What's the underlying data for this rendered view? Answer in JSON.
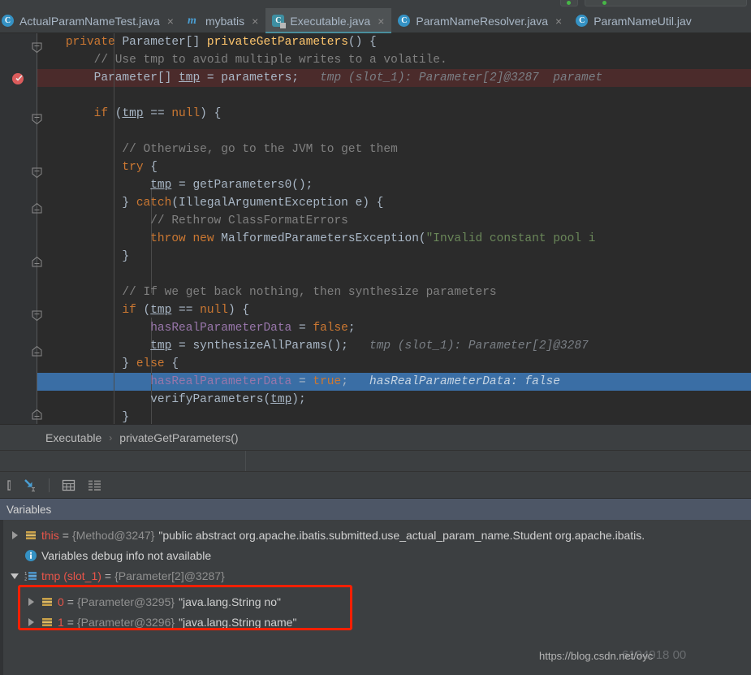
{
  "window": {
    "theme_bg": "#3c3f41",
    "editor_bg": "#2b2b2b",
    "accent": "#3a6ea5"
  },
  "tabs": [
    {
      "label": "ActualParamNameTest.java",
      "icon": "java-class-icon",
      "close": "×",
      "active": false
    },
    {
      "label": "mybatis",
      "icon": "maven-module-icon",
      "close": "×",
      "active": false
    },
    {
      "label": "Executable.java",
      "icon": "java-class-readonly-icon",
      "close": "×",
      "active": true
    },
    {
      "label": "ParamNameResolver.java",
      "icon": "java-class-icon",
      "close": "×",
      "active": false
    },
    {
      "label": "ParamNameUtil.jav",
      "icon": "java-class-icon",
      "close": "",
      "active": false
    }
  ],
  "editor": {
    "lines": [
      {
        "indent": 4,
        "tokens": [
          {
            "t": "private ",
            "c": "kw"
          },
          {
            "t": "Parameter",
            "c": "type"
          },
          {
            "t": "[] ",
            "c": "type"
          },
          {
            "t": "privateGetParameters",
            "c": "fn"
          },
          {
            "t": "() {",
            "c": "type"
          }
        ]
      },
      {
        "indent": 8,
        "tokens": [
          {
            "t": "// Use tmp to avoid multiple writes to a volatile.",
            "c": "cmt"
          }
        ]
      },
      {
        "indent": 8,
        "highlight": "red",
        "tokens": [
          {
            "t": "Parameter",
            "c": "type"
          },
          {
            "t": "[] ",
            "c": "type"
          },
          {
            "t": "tmp",
            "c": "loc"
          },
          {
            "t": " = parameters;",
            "c": "type"
          },
          {
            "t": "   tmp (slot_1): Parameter[2]@3287  paramet",
            "c": "hint"
          }
        ]
      },
      {
        "indent": 0,
        "tokens": []
      },
      {
        "indent": 8,
        "tokens": [
          {
            "t": "if",
            "c": "kw"
          },
          {
            "t": " (",
            "c": "type"
          },
          {
            "t": "tmp",
            "c": "loc"
          },
          {
            "t": " == ",
            "c": "type"
          },
          {
            "t": "null",
            "c": "kw"
          },
          {
            "t": ") {",
            "c": "type"
          }
        ]
      },
      {
        "indent": 0,
        "tokens": []
      },
      {
        "indent": 12,
        "tokens": [
          {
            "t": "// Otherwise, go to the JVM to get them",
            "c": "cmt"
          }
        ]
      },
      {
        "indent": 12,
        "tokens": [
          {
            "t": "try",
            "c": "kw"
          },
          {
            "t": " {",
            "c": "type"
          }
        ]
      },
      {
        "indent": 16,
        "tokens": [
          {
            "t": "tmp",
            "c": "loc"
          },
          {
            "t": " = getParameters0();",
            "c": "type"
          }
        ]
      },
      {
        "indent": 12,
        "tokens": [
          {
            "t": "} ",
            "c": "type"
          },
          {
            "t": "catch",
            "c": "kw"
          },
          {
            "t": "(IllegalArgumentException e) {",
            "c": "type"
          }
        ]
      },
      {
        "indent": 16,
        "tokens": [
          {
            "t": "// Rethrow ClassFormatErrors",
            "c": "cmt"
          }
        ]
      },
      {
        "indent": 16,
        "tokens": [
          {
            "t": "throw",
            "c": "kw"
          },
          {
            "t": " ",
            "c": "type"
          },
          {
            "t": "new",
            "c": "kw"
          },
          {
            "t": " MalformedParametersException(",
            "c": "type"
          },
          {
            "t": "\"Invalid constant pool i",
            "c": "str"
          }
        ]
      },
      {
        "indent": 12,
        "tokens": [
          {
            "t": "}",
            "c": "type"
          }
        ]
      },
      {
        "indent": 0,
        "tokens": []
      },
      {
        "indent": 12,
        "tokens": [
          {
            "t": "// If we get back nothing, then synthesize parameters",
            "c": "cmt"
          }
        ]
      },
      {
        "indent": 12,
        "tokens": [
          {
            "t": "if",
            "c": "kw"
          },
          {
            "t": " (",
            "c": "type"
          },
          {
            "t": "tmp",
            "c": "loc"
          },
          {
            "t": " == ",
            "c": "type"
          },
          {
            "t": "null",
            "c": "kw"
          },
          {
            "t": ") {",
            "c": "type"
          }
        ]
      },
      {
        "indent": 16,
        "tokens": [
          {
            "t": "hasRealParameterData",
            "c": "fld"
          },
          {
            "t": " = ",
            "c": "type"
          },
          {
            "t": "false",
            "c": "kw"
          },
          {
            "t": ";",
            "c": "type"
          }
        ]
      },
      {
        "indent": 16,
        "tokens": [
          {
            "t": "tmp",
            "c": "loc"
          },
          {
            "t": " = synthesizeAllParams();",
            "c": "type"
          },
          {
            "t": "   tmp (slot_1): Parameter[2]@3287",
            "c": "hint"
          }
        ]
      },
      {
        "indent": 12,
        "tokens": [
          {
            "t": "} ",
            "c": "type"
          },
          {
            "t": "else",
            "c": "kw"
          },
          {
            "t": " {",
            "c": "type"
          }
        ]
      },
      {
        "indent": 16,
        "highlight": "blue",
        "tokens": [
          {
            "t": "hasRealParameterData",
            "c": "fld"
          },
          {
            "t": " = ",
            "c": "type"
          },
          {
            "t": "true",
            "c": "kw"
          },
          {
            "t": ";",
            "c": "type"
          },
          {
            "t": "   hasRealParameterData: false",
            "c": "hint-b"
          }
        ]
      },
      {
        "indent": 16,
        "tokens": [
          {
            "t": "verifyParameters(",
            "c": "type"
          },
          {
            "t": "tmp",
            "c": "loc"
          },
          {
            "t": ");",
            "c": "type"
          }
        ]
      },
      {
        "indent": 12,
        "tokens": [
          {
            "t": "}",
            "c": "type"
          }
        ]
      }
    ],
    "breakpoint": {
      "name": "breakpoint-verified-icon",
      "line": 2
    }
  },
  "breadcrumb": {
    "class": "Executable",
    "separator": "›",
    "method": "privateGetParameters()"
  },
  "debug_toolbar": {
    "buttons": [
      {
        "name": "step-into-icon",
        "label": ""
      },
      {
        "name": "evaluate-expression-icon",
        "label": ""
      },
      {
        "name": "show-values-inline-icon",
        "label": ""
      }
    ]
  },
  "variables_panel": {
    "title": "Variables",
    "rows": [
      {
        "indent": 0,
        "twisty": "closed",
        "icon": "field-icon",
        "name": "this",
        "eq": "=",
        "ref": "{Method@3247}",
        "value": "\"public abstract org.apache.ibatis.submitted.use_actual_param_name.Student org.apache.ibatis.",
        "kind": "object"
      },
      {
        "indent": 1,
        "twisty": "none",
        "icon": "info-icon",
        "info": "Variables debug info not available",
        "kind": "info"
      },
      {
        "indent": 0,
        "twisty": "open",
        "icon": "array-icon",
        "name": "tmp (slot_1)",
        "eq": "=",
        "ref": "{Parameter[2]@3287}",
        "value": "",
        "kind": "object"
      },
      {
        "indent": 1,
        "twisty": "closed",
        "icon": "field-icon",
        "name": "0",
        "eq": "=",
        "ref": "{Parameter@3295}",
        "value": "\"java.lang.String no\"",
        "kind": "object",
        "boxed": true
      },
      {
        "indent": 1,
        "twisty": "closed",
        "icon": "field-icon",
        "name": "1",
        "eq": "=",
        "ref": "{Parameter@3296}",
        "value": "\"java.lang.String name\"",
        "kind": "object",
        "boxed": true
      }
    ],
    "highlight_box_color": "#fe1f00"
  },
  "watermark": {
    "url": "https://blog.csdn.net/oyc",
    "ghost": "6194918 00"
  }
}
